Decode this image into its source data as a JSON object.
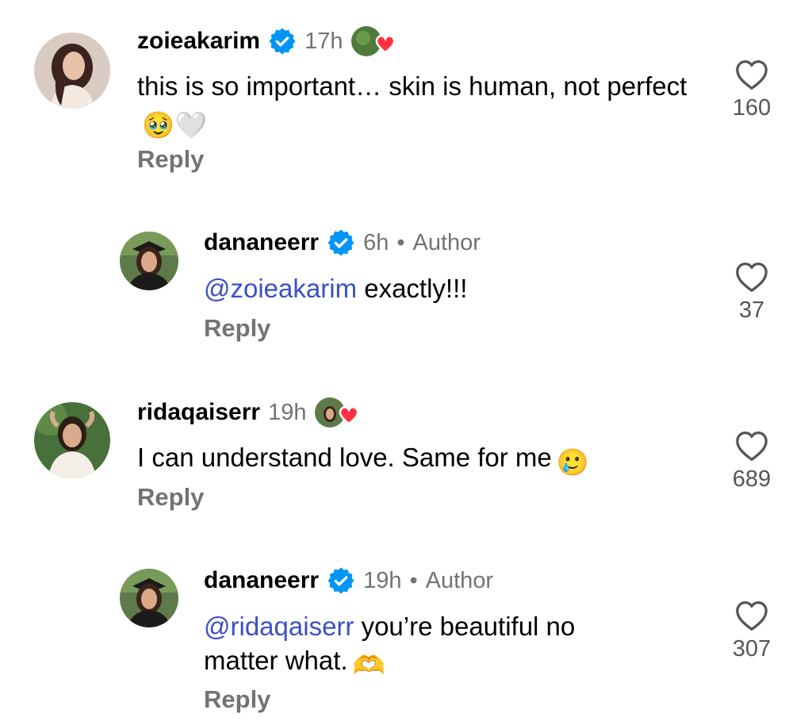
{
  "comments": [
    {
      "username": "zoieakarim",
      "time": "17h",
      "text": "this is so important… skin is human, not perfect",
      "emojis": "🥹🤍",
      "reply": "Reply",
      "likes": "160",
      "liked_by_author": true
    },
    {
      "username": "dananeerr",
      "time": "6h",
      "author_tag": "Author",
      "mention": "@zoieakarim",
      "text": " exactly!!!",
      "reply": "Reply",
      "likes": "37"
    },
    {
      "username": "ridaqaiserr",
      "time": "19h",
      "text": "I can understand love. Same for me",
      "emojis": "🥲",
      "reply": "Reply",
      "likes": "689",
      "liked_by_author": true
    },
    {
      "username": "dananeerr",
      "time": "19h",
      "author_tag": "Author",
      "mention": "@ridaqaiserr",
      "text": " you’re beautiful no matter what.",
      "emojis": "🫶",
      "reply": "Reply",
      "likes": "307"
    }
  ],
  "separator": "•",
  "colors": {
    "mention": "#3b4fc7",
    "secondary_text": "#737373",
    "verified_badge": "#0095f6",
    "heart_badge": "#ff3040"
  },
  "icons": {
    "verified": "verified-badge-icon",
    "like": "heart-outline-icon",
    "liked_by_author": "author-liked-heart-icon"
  }
}
